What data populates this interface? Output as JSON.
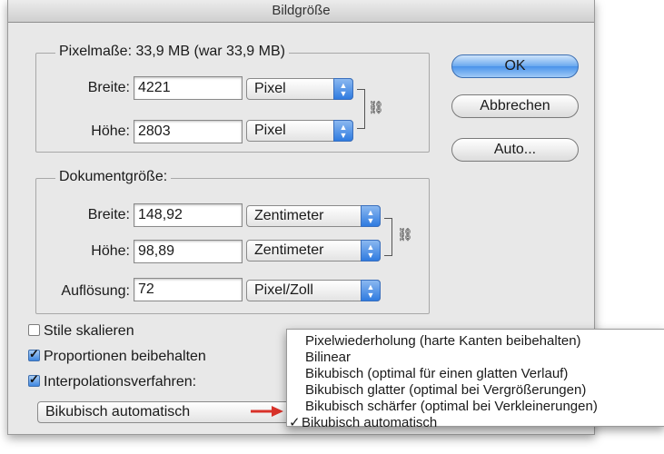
{
  "dialog": {
    "title": "Bildgröße",
    "pixel_group": {
      "legend": "Pixelmaße: 33,9 MB (war 33,9 MB)",
      "width_label": "Breite:",
      "width_value": "4221",
      "width_unit": "Pixel",
      "height_label": "Höhe:",
      "height_value": "2803",
      "height_unit": "Pixel"
    },
    "doc_group": {
      "legend": "Dokumentgröße:",
      "width_label": "Breite:",
      "width_value": "148,92",
      "width_unit": "Zentimeter",
      "height_label": "Höhe:",
      "height_value": "98,89",
      "height_unit": "Zentimeter",
      "res_label": "Auflösung:",
      "res_value": "72",
      "res_unit": "Pixel/Zoll"
    },
    "buttons": {
      "ok": "OK",
      "cancel": "Abbrechen",
      "auto": "Auto..."
    },
    "checkboxes": [
      {
        "label": "Stile skalieren",
        "checked": false
      },
      {
        "label": "Proportionen beibehalten",
        "checked": true
      },
      {
        "label": "Interpolationsverfahren:",
        "checked": true
      }
    ],
    "interpolation_selected": "Bikubisch automatisch"
  },
  "menu": {
    "items": [
      {
        "label": "Pixelwiederholung (harte Kanten beibehalten)",
        "checked": false
      },
      {
        "label": "Bilinear",
        "checked": false
      },
      {
        "label": "Bikubisch (optimal für einen glatten Verlauf)",
        "checked": false
      },
      {
        "label": "Bikubisch glatter (optimal bei Vergrößerungen)",
        "checked": false
      },
      {
        "label": "Bikubisch schärfer (optimal bei Verkleinerungen)",
        "checked": false
      },
      {
        "label": "Bikubisch automatisch",
        "checked": true
      }
    ],
    "check_mark": "✓"
  },
  "colors": {
    "arrow": "#d8322a",
    "accent": "#4a93ea"
  },
  "icons": {
    "link": "chain-link-icon",
    "stepper": "up-down-arrows-icon",
    "pointer": "red-arrow-icon"
  }
}
